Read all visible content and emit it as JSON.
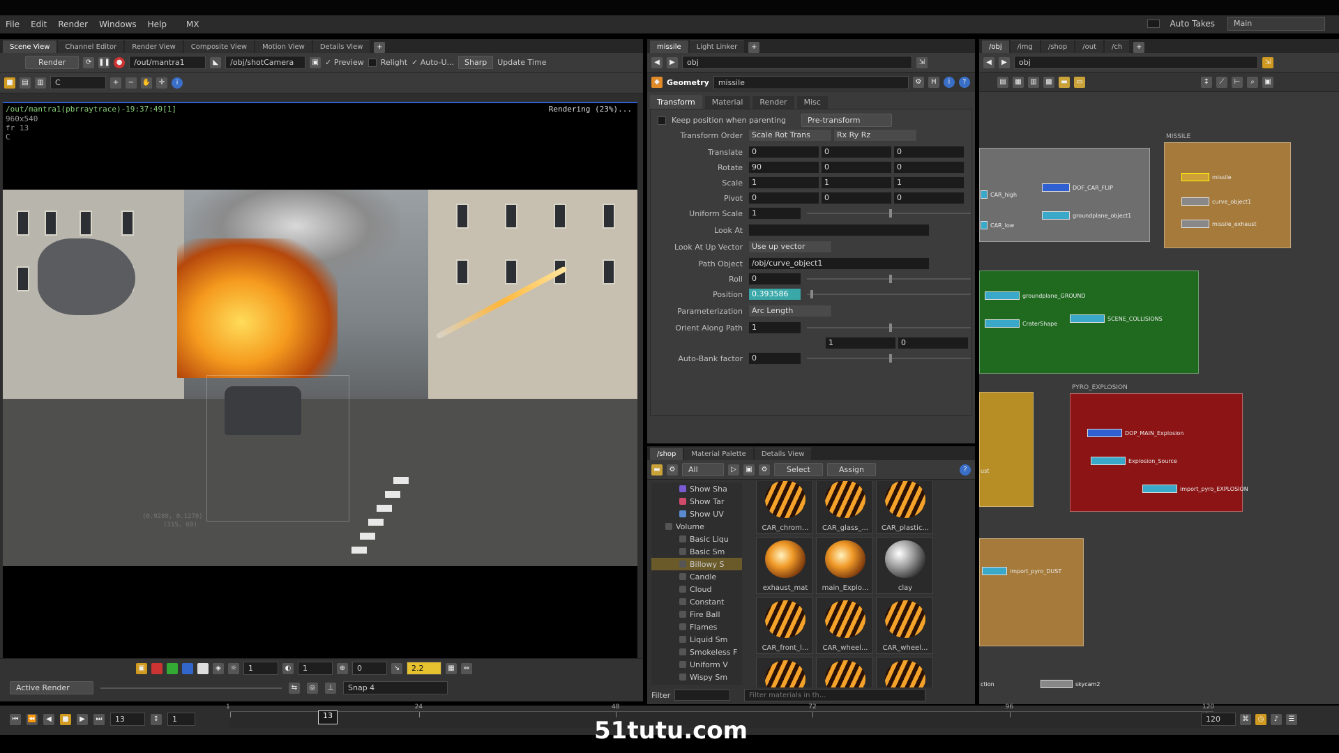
{
  "menu": [
    "File",
    "Edit",
    "Render",
    "Windows",
    "Help",
    "MX"
  ],
  "top_right": {
    "auto_takes": "Auto Takes",
    "main": "Main"
  },
  "left_pane": {
    "tabs": [
      "Scene View",
      "Channel Editor",
      "Render View",
      "Composite View",
      "Motion View",
      "Details View"
    ],
    "toolbar": {
      "render_btn": "Render",
      "rop_path": "/out/mantra1",
      "camera_path": "/obj/shotCamera",
      "preview": "Preview",
      "relight": "Relight",
      "auto_update": "Auto-U...",
      "sharp": "Sharp",
      "update_time": "Update Time"
    },
    "channel_field": "C",
    "render_info": {
      "title": "/out/mantra1(pbrraytrace)-19:37:49[1]",
      "res": "960x540",
      "fr": "fr 13",
      "c": "C",
      "status": "Rendering (23%)...",
      "coords": "(0.9289, 0.1278)",
      "coords2": "(315, 69)"
    },
    "bottom": {
      "val1": "1",
      "val2": "1",
      "val3": "0",
      "gamma": "2.2",
      "active_render": "Active Render",
      "snap": "Snap 4"
    }
  },
  "mid_pane": {
    "tabs": [
      "missile",
      "Light Linker"
    ],
    "path": "obj",
    "node_type": "Geometry",
    "node_name": "missile",
    "param_tabs": [
      "Transform",
      "Material",
      "Render",
      "Misc"
    ],
    "keep_pos": "Keep position when parenting",
    "pre_transform": "Pre-transform",
    "params": [
      {
        "label": "Transform Order",
        "values": [
          "Scale Rot Trans",
          "Rx Ry Rz"
        ]
      },
      {
        "label": "Translate",
        "values": [
          "0",
          "0",
          "0"
        ]
      },
      {
        "label": "Rotate",
        "values": [
          "90",
          "0",
          "0"
        ]
      },
      {
        "label": "Scale",
        "values": [
          "1",
          "1",
          "1"
        ]
      },
      {
        "label": "Pivot",
        "values": [
          "0",
          "0",
          "0"
        ]
      },
      {
        "label": "Uniform Scale",
        "values": [
          "1"
        ]
      },
      {
        "label": "Look At",
        "values": [
          ""
        ]
      },
      {
        "label": "Look At Up Vector",
        "values": [
          "Use up vector"
        ]
      },
      {
        "label": "Path Object",
        "values": [
          "/obj/curve_object1"
        ]
      },
      {
        "label": "Roll",
        "values": [
          "0"
        ]
      },
      {
        "label": "Position",
        "values": [
          "0.393586"
        ]
      },
      {
        "label": "Parameterization",
        "values": [
          "Arc Length"
        ]
      },
      {
        "label": "Orient Along Path",
        "values": [
          "1"
        ]
      },
      {
        "label": "",
        "values": [
          "1",
          "0"
        ]
      },
      {
        "label": "Auto-Bank factor",
        "values": [
          "0"
        ]
      }
    ]
  },
  "mat_pane": {
    "tabs": [
      "/shop",
      "Material Palette",
      "Details View"
    ],
    "all": "All",
    "select": "Select",
    "assign": "Assign",
    "tree": [
      "Show Sha",
      "Show Tar",
      "Show UV",
      "Volume",
      "Basic Liqu",
      "Basic Sm",
      "Billowy S",
      "Candle",
      "Cloud",
      "Constant",
      "Fire Ball",
      "Flames",
      "Liquid Sm",
      "Smokeless F",
      "Uniform V",
      "Wispy Sm"
    ],
    "materials": [
      "CAR_chrom...",
      "CAR_glass_...",
      "CAR_plastic...",
      "exhaust_mat",
      "main_Explo...",
      "clay",
      "CAR_front_l...",
      "CAR_wheel...",
      "CAR_wheel..."
    ],
    "filter": "Filter",
    "filter_placeholder": "Filter materials in th..."
  },
  "net_pane": {
    "tabs": [
      "/obj",
      "/img",
      "/shop",
      "/out",
      "/ch"
    ],
    "path": "obj",
    "box_titles": [
      "MISSILE",
      "PYRO_EXPLOSION"
    ],
    "nodes": [
      "CAR_high",
      "CAR_low",
      "DOF_CAR_FLIP",
      "groundplane_object1",
      "missile",
      "curve_object1",
      "missile_exhaust",
      "groundplane_GROUND",
      "CraterShape",
      "SCENE_COLLISIONS",
      "DOP_MAIN_Explosion",
      "Explosion_Source",
      "import_pyro_EXPLOSION",
      "import_pyro_DUST",
      "skycam2",
      "ust",
      "ction"
    ]
  },
  "timeline": {
    "frame": "13",
    "step": "1",
    "start": "1",
    "end": "120",
    "current": "13",
    "ticks": [
      "1",
      "24",
      "48",
      "72",
      "96",
      "120"
    ]
  },
  "watermark": "51tutu.com"
}
